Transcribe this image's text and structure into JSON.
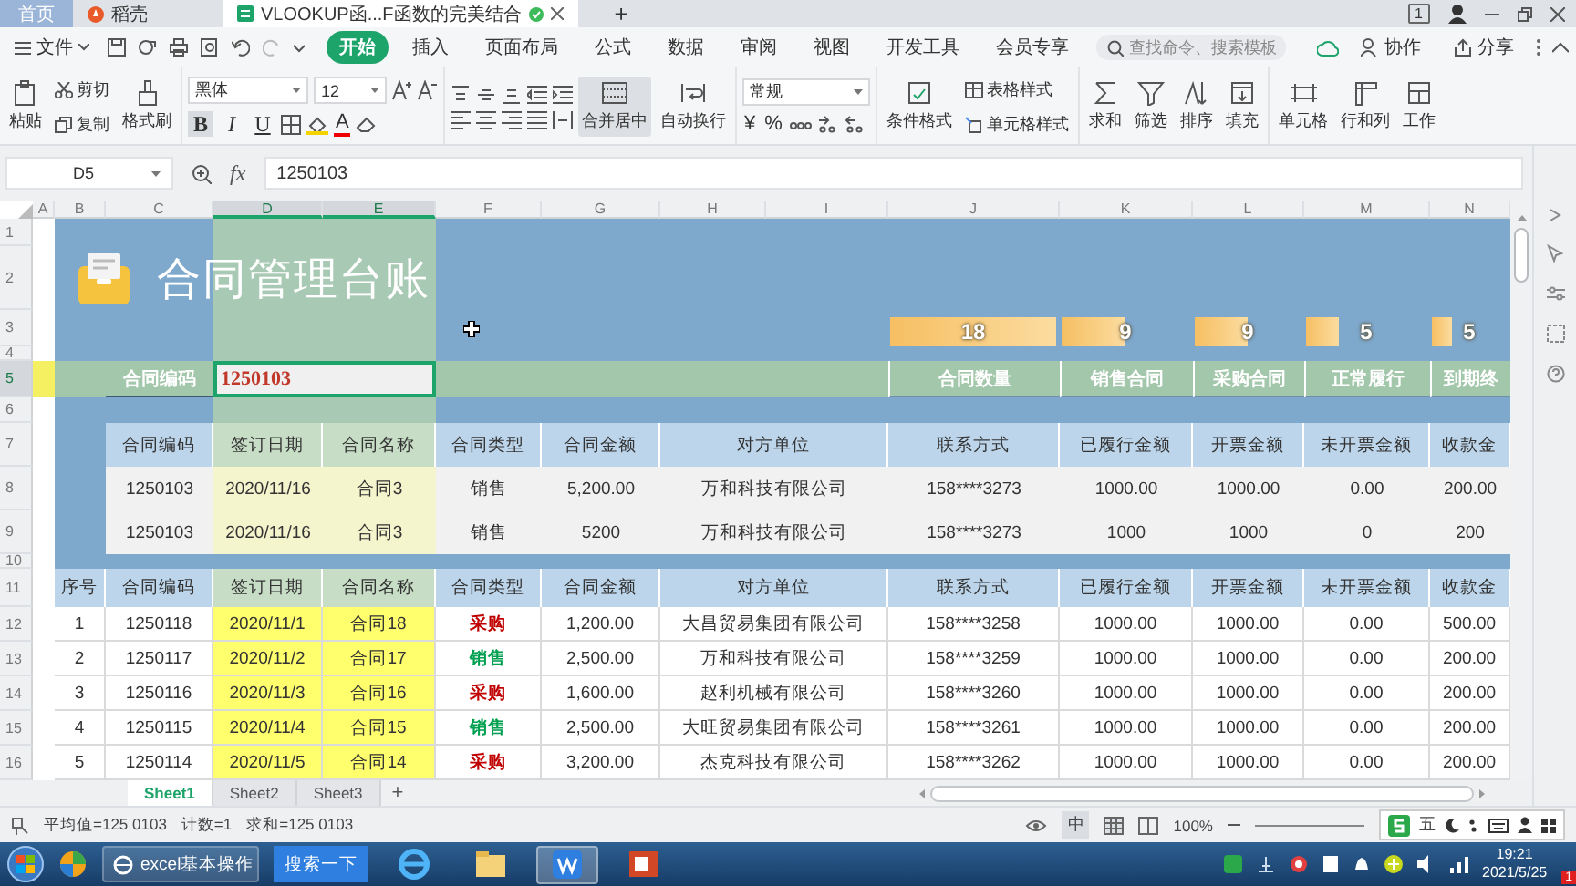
{
  "app_tabs": [
    {
      "label": "首页",
      "selected": false,
      "kind": "home"
    },
    {
      "label": "稻壳",
      "selected": false,
      "kind": "docer"
    },
    {
      "label": "VLOOKUP函...F函数的完美结合",
      "selected": true,
      "kind": "sheet"
    }
  ],
  "new_tab": "+",
  "notifications": "1",
  "menu": {
    "file": "文件",
    "tabs": [
      {
        "label": "开始",
        "selected": true
      },
      {
        "label": "插入",
        "selected": false
      },
      {
        "label": "页面布局",
        "selected": false
      },
      {
        "label": "公式",
        "selected": false
      },
      {
        "label": "数据",
        "selected": false
      },
      {
        "label": "审阅",
        "selected": false
      },
      {
        "label": "视图",
        "selected": false
      },
      {
        "label": "开发工具",
        "selected": false
      },
      {
        "label": "会员专享",
        "selected": false
      }
    ],
    "search": {
      "placeholder": "查找命令、搜索模板"
    },
    "actions": [
      "协作",
      "分享"
    ]
  },
  "ribbon": {
    "paste": "粘贴",
    "cut": "剪切",
    "copy": "复制",
    "format_painter": "格式刷",
    "font_name": "黑体",
    "font_size": "12",
    "style_buttons": [
      {
        "label": "B",
        "on": true
      },
      {
        "label": "I",
        "on": false
      },
      {
        "label": "U",
        "on": false
      }
    ],
    "font_color": "A",
    "merge_center": {
      "label": "合并居中",
      "on": true
    },
    "wrap": "自动换行",
    "number_format": "常规",
    "number_buttons": [
      "¥",
      "%"
    ],
    "conditional": "条件格式",
    "table_style": "表格样式",
    "cell_style": "单元格样式",
    "tools": [
      "求和",
      "筛选",
      "排序",
      "填充",
      "单元格",
      "行和列",
      "工作"
    ]
  },
  "formula_bar": {
    "cell": "D5",
    "fx": "fx",
    "value": "1250103"
  },
  "sheet": {
    "columns": [
      {
        "label": "A",
        "selected": false
      },
      {
        "label": "B",
        "selected": false
      },
      {
        "label": "C",
        "selected": false
      },
      {
        "label": "D",
        "selected": true
      },
      {
        "label": "E",
        "selected": true
      },
      {
        "label": "F",
        "selected": false
      },
      {
        "label": "G",
        "selected": false
      },
      {
        "label": "H",
        "selected": false
      },
      {
        "label": "I",
        "selected": false
      },
      {
        "label": "J",
        "selected": false
      },
      {
        "label": "K",
        "selected": false
      },
      {
        "label": "L",
        "selected": false
      },
      {
        "label": "M",
        "selected": false
      },
      {
        "label": "N",
        "selected": false
      }
    ],
    "rows": [
      {
        "label": "1",
        "selected": false
      },
      {
        "label": "2",
        "selected": false
      },
      {
        "label": "3",
        "selected": false
      },
      {
        "label": "4",
        "selected": false
      },
      {
        "label": "5",
        "selected": true
      },
      {
        "label": "6",
        "selected": false
      },
      {
        "label": "7",
        "selected": false
      },
      {
        "label": "8",
        "selected": false
      },
      {
        "label": "9",
        "selected": false
      },
      {
        "label": "10",
        "selected": false
      },
      {
        "label": "11",
        "selected": false
      },
      {
        "label": "12",
        "selected": false
      },
      {
        "label": "13",
        "selected": false
      },
      {
        "label": "14",
        "selected": false
      },
      {
        "label": "15",
        "selected": false
      },
      {
        "label": "16",
        "selected": false
      }
    ]
  },
  "title": "合同管理台账",
  "kpis": [
    {
      "label": "合同数量",
      "value": "18"
    },
    {
      "label": "销售合同",
      "value": "9"
    },
    {
      "label": "采购合同",
      "value": "9"
    },
    {
      "label": "正常履行",
      "value": "5"
    },
    {
      "label": "到期终",
      "value": "5"
    }
  ],
  "lookup": {
    "label": "合同编码",
    "value": "1250103"
  },
  "lookup_table": {
    "columns": [
      "合同编码",
      "签订日期",
      "合同名称",
      "合同类型",
      "合同金额",
      "对方单位",
      "联系方式",
      "已履行金额",
      "开票金额",
      "未开票金额",
      "收款金"
    ],
    "rows": [
      [
        "1250103",
        "2020/11/16",
        "合同3",
        "销售",
        "5,200.00",
        "万和科技有限公司",
        "158****3273",
        "1000.00",
        "1000.00",
        "0.00",
        "200.00"
      ],
      [
        "1250103",
        "2020/11/16",
        "合同3",
        "销售",
        "5200",
        "万和科技有限公司",
        "158****3273",
        "1000",
        "1000",
        "0",
        "200"
      ]
    ]
  },
  "contracts": {
    "columns": [
      "序号",
      "合同编码",
      "签订日期",
      "合同名称",
      "合同类型",
      "合同金额",
      "对方单位",
      "联系方式",
      "已履行金额",
      "开票金额",
      "未开票金额",
      "收款金"
    ],
    "rows": [
      {
        "cells": [
          "1",
          "1250118",
          "2020/11/1",
          "合同18",
          "采购",
          "1,200.00",
          "大昌贸易集团有限公司",
          "158****3258",
          "1000.00",
          "1000.00",
          "0.00",
          "500.00"
        ],
        "color": "#c00000"
      },
      {
        "cells": [
          "2",
          "1250117",
          "2020/11/2",
          "合同17",
          "销售",
          "2,500.00",
          "万和科技有限公司",
          "158****3259",
          "1000.00",
          "1000.00",
          "0.00",
          "200.00"
        ],
        "color": "#00a050"
      },
      {
        "cells": [
          "3",
          "1250116",
          "2020/11/3",
          "合同16",
          "采购",
          "1,600.00",
          "赵利机械有限公司",
          "158****3260",
          "1000.00",
          "1000.00",
          "0.00",
          "200.00"
        ],
        "color": "#c00000"
      },
      {
        "cells": [
          "4",
          "1250115",
          "2020/11/4",
          "合同15",
          "销售",
          "2,500.00",
          "大旺贸易集团有限公司",
          "158****3261",
          "1000.00",
          "1000.00",
          "0.00",
          "200.00"
        ],
        "color": "#00a050"
      },
      {
        "cells": [
          "5",
          "1250114",
          "2020/11/5",
          "合同14",
          "采购",
          "3,200.00",
          "杰克科技有限公司",
          "158****3262",
          "1000.00",
          "1000.00",
          "0.00",
          "200.00"
        ],
        "color": "#c00000"
      }
    ]
  },
  "sheet_tabs": [
    {
      "label": "Sheet1",
      "selected": true
    },
    {
      "label": "Sheet2",
      "selected": false
    },
    {
      "label": "Sheet3",
      "selected": false
    }
  ],
  "add_sheet": "+",
  "status_bar": {
    "stats": [
      "平均值=125 0103",
      "计数=1",
      "求和=125 0103"
    ],
    "input_mode": "中",
    "zoom": "100%",
    "ime": "五"
  },
  "taskbar": {
    "window": "excel基本操作",
    "search_button": "搜索一下",
    "time": "19:21",
    "date": "2021/5/25",
    "badge": "1"
  }
}
